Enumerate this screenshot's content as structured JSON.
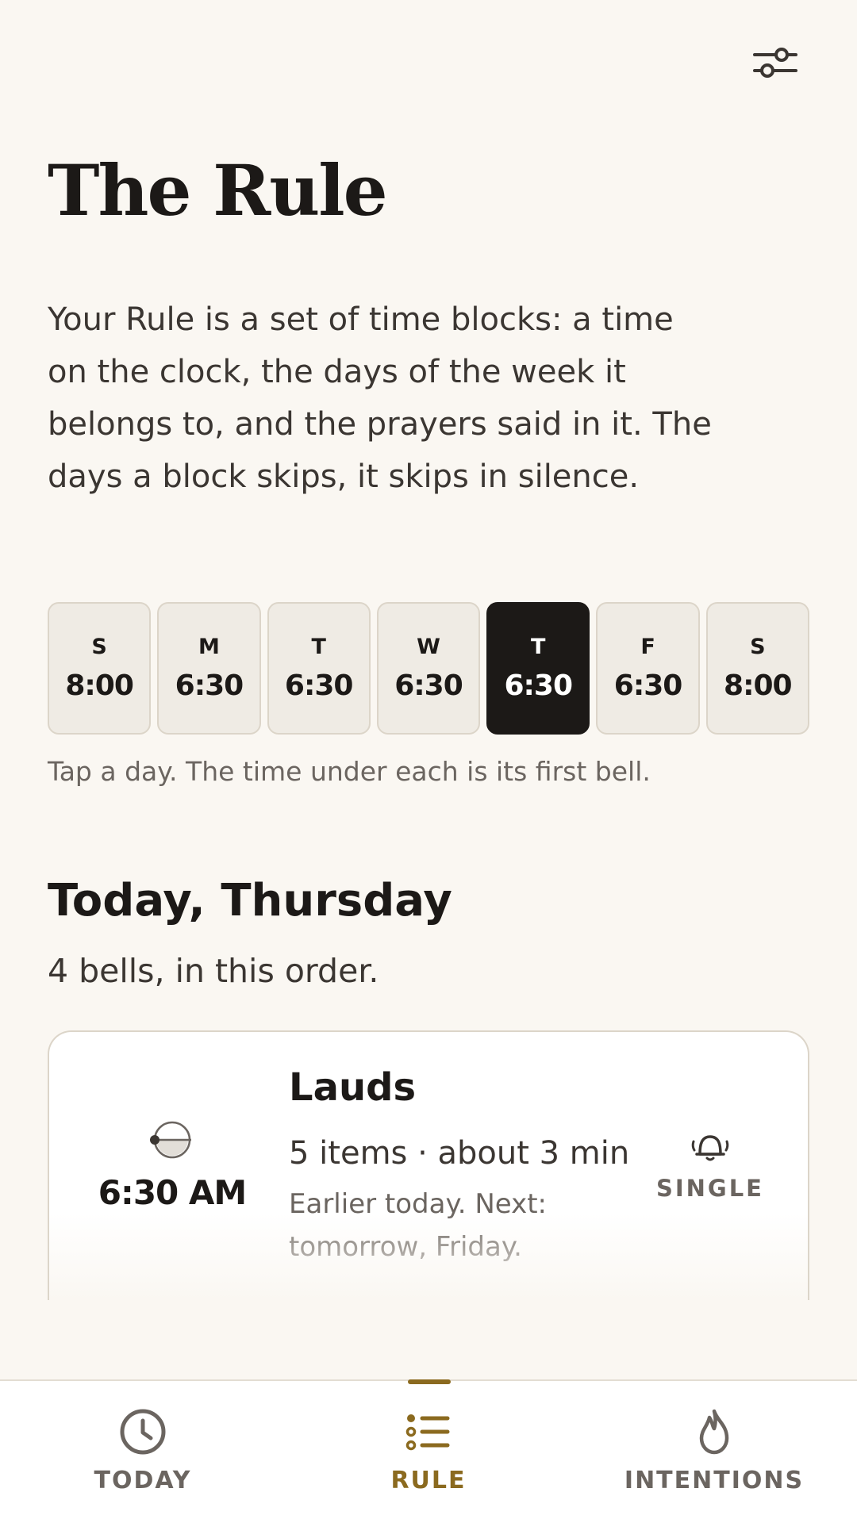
{
  "header": {
    "settings_icon": "sliders-icon"
  },
  "page": {
    "title": "The Rule",
    "intro": "Your Rule is a set of time blocks: a time on the clock, the days of the week it belongs to, and the prayers said in it. The days a block skips, it skips in silence."
  },
  "week": {
    "days": [
      {
        "letter": "S",
        "time": "8:00",
        "selected": false
      },
      {
        "letter": "M",
        "time": "6:30",
        "selected": false
      },
      {
        "letter": "T",
        "time": "6:30",
        "selected": false
      },
      {
        "letter": "W",
        "time": "6:30",
        "selected": false
      },
      {
        "letter": "T",
        "time": "6:30",
        "selected": true
      },
      {
        "letter": "F",
        "time": "6:30",
        "selected": false
      },
      {
        "letter": "S",
        "time": "8:00",
        "selected": false
      }
    ],
    "hint": "Tap a day. The time under each is its first bell."
  },
  "today": {
    "title": "Today, Thursday",
    "subtitle": "4 bells, in this order.",
    "blocks": [
      {
        "time": "6:30 AM",
        "icon": "sunrise-icon",
        "name": "Lauds",
        "meta": "5 items · about 3 min",
        "note": "Earlier today. Next: tomorrow, Friday.",
        "bell_icon": "bell-icon",
        "bell_label": "SINGLE"
      }
    ]
  },
  "tabs": {
    "items": [
      {
        "label": "TODAY",
        "icon": "clock-icon",
        "active": false
      },
      {
        "label": "RULE",
        "icon": "list-icon",
        "active": true
      },
      {
        "label": "INTENTIONS",
        "icon": "flame-icon",
        "active": false
      }
    ]
  },
  "colors": {
    "background": "#faf7f2",
    "text": "#1c1917",
    "muted": "#6b6560",
    "accent": "#8b6a1f",
    "selected_day": "#1c1917"
  }
}
